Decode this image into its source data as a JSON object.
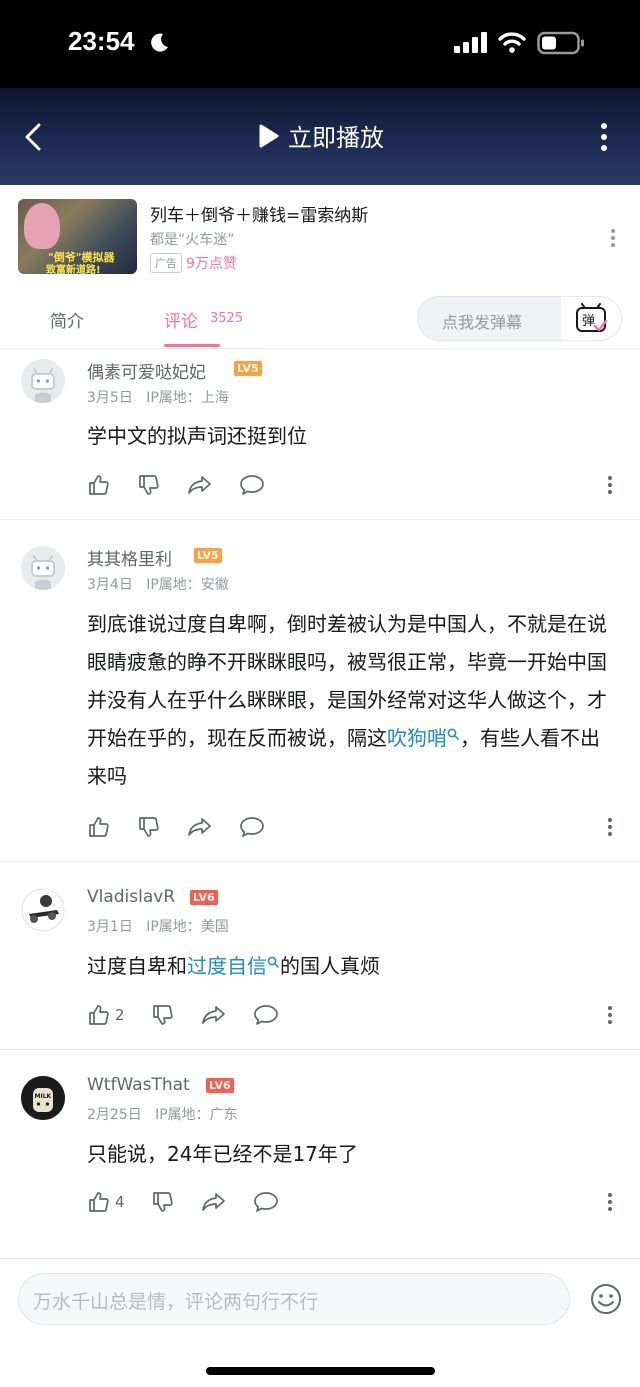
{
  "status": {
    "time": "23:54"
  },
  "player": {
    "play_label": "立即播放"
  },
  "ad": {
    "thumb_line1": "\"倒爷\"模拟器",
    "thumb_line2": "致富新道路!",
    "title": "列车＋倒爷＋赚钱=雷索纳斯",
    "subtitle": "都是“火车迷”",
    "tag": "广告",
    "likes": "9万点赞"
  },
  "tabs": {
    "intro": "简介",
    "comments": "评论",
    "comment_count": "3525",
    "danmu_placeholder": "点我发弹幕",
    "danmu_btn_icon": "弹"
  },
  "comments": [
    {
      "username": "偶素可爱哒妃妃",
      "level": "LV5",
      "date": "3月5日",
      "ip": "IP属地：上海",
      "text_parts": [
        "学中文的拟声词还挺到位"
      ],
      "likes": ""
    },
    {
      "username": "其其格里利",
      "level": "LV5",
      "date": "3月4日",
      "ip": "IP属地：安徽",
      "text_before": "到底谁说过度自卑啊，倒时差被认为是中国人，不就是在说眼睛疲惫的睁不开眯眯眼吗，被骂很正常，毕竟一开始中国并没有人在乎什么眯眯眼，是国外经常对这华人做这个，才开始在乎的，现在反而被说，隔这",
      "link": "吹狗哨",
      "text_after": "，有些人看不出来吗",
      "likes": ""
    },
    {
      "username": "VladislavR",
      "level": "LV6",
      "date": "3月1日",
      "ip": "IP属地：美国",
      "text_before": "过度自卑和",
      "link": "过度自信",
      "text_after": "的国人真烦",
      "likes": "2"
    },
    {
      "username": "WtfWasThat",
      "level": "LV6",
      "date": "2月25日",
      "ip": "IP属地：广东",
      "text_parts": [
        "只能说，24年已经不是17年了"
      ],
      "likes": "4",
      "avatar_text": "MILK"
    }
  ],
  "bottom": {
    "placeholder": "万水千山总是情，评论两句行不行"
  },
  "colors": {
    "accent": "#fb7299",
    "link": "#1a8ccc",
    "lv5": "#ff9f3f",
    "lv6": "#ff5a4a"
  }
}
